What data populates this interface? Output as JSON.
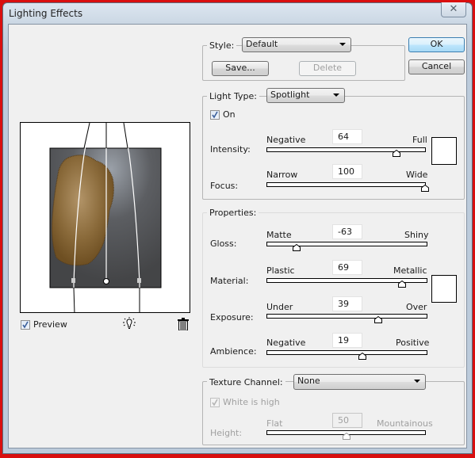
{
  "window": {
    "title": "Lighting Effects",
    "close_label": "✕"
  },
  "buttons": {
    "ok": "OK",
    "cancel": "Cancel"
  },
  "style_group": {
    "label": "Style:",
    "selected": "Default",
    "save": "Save...",
    "delete": "Delete"
  },
  "light_type_group": {
    "label": "Light Type:",
    "selected": "Spotlight",
    "on_label": "On",
    "on_checked": true,
    "intensity": {
      "label": "Intensity:",
      "min_label": "Negative",
      "max_label": "Full",
      "value": "64",
      "range": [
        -100,
        100
      ]
    },
    "focus": {
      "label": "Focus:",
      "min_label": "Narrow",
      "max_label": "Wide",
      "value": "100",
      "range": [
        -100,
        100
      ]
    },
    "light_color": "#ffffff"
  },
  "properties_group": {
    "label": "Properties:",
    "gloss": {
      "label": "Gloss:",
      "min_label": "Matte",
      "max_label": "Shiny",
      "value": "-63",
      "range": [
        -100,
        100
      ]
    },
    "material": {
      "label": "Material:",
      "min_label": "Plastic",
      "max_label": "Metallic",
      "value": "69",
      "range": [
        -100,
        100
      ]
    },
    "exposure": {
      "label": "Exposure:",
      "min_label": "Under",
      "max_label": "Over",
      "value": "39",
      "range": [
        -100,
        100
      ]
    },
    "ambience": {
      "label": "Ambience:",
      "min_label": "Negative",
      "max_label": "Positive",
      "value": "19",
      "range": [
        -100,
        100
      ]
    },
    "ambient_color": "#ffffff"
  },
  "texture_group": {
    "label": "Texture Channel:",
    "selected": "None",
    "white_is_high_label": "White is high",
    "white_is_high_checked": true,
    "height": {
      "label": "Height:",
      "min_label": "Flat",
      "max_label": "Mountainous",
      "value": "50",
      "range": [
        0,
        100
      ]
    }
  },
  "preview": {
    "label": "Preview",
    "checked": true,
    "new_light_icon": "lightbulb-icon",
    "delete_light_icon": "trash-icon"
  }
}
